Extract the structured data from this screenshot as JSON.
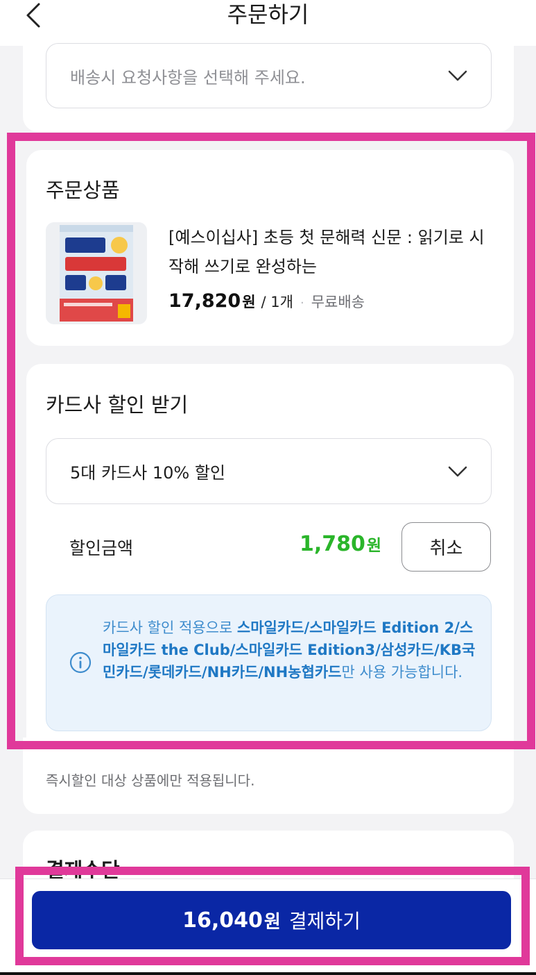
{
  "header": {
    "title": "주문하기",
    "back_icon": "chevron-left-icon"
  },
  "delivery_request": {
    "placeholder": "배송시 요청사항을 선택해 주세요.",
    "icon": "chevron-down-icon"
  },
  "order_product": {
    "section_title": "주문상품",
    "thumbnail_icon": "book-cover-image",
    "product_name": "[예스이십사] 초등 첫 문해력 신문 : 읽기로 시작해 쓰기로 완성하는",
    "price": "17,820",
    "price_unit": "원",
    "quantity": "/ 1개",
    "separator": "·",
    "shipping": "무료배송"
  },
  "card_discount": {
    "section_title": "카드사 할인 받기",
    "selected_option": "5대 카드사 10% 할인",
    "discount_label": "할인금액",
    "discount_amount": "1,780",
    "discount_unit": "원",
    "cancel_label": "취소",
    "info_icon": "info-circle-icon",
    "info_prefix": "카드사 할인 적용으로 ",
    "info_cards": "스마일카드/스마일카드 Edition 2/스마일카드 the Club/스마일카드 Edition3/삼성카드/KB국민카드/롯데카드/NH카드/NH농협카드",
    "info_suffix": "만 사용 가능합니다.",
    "note": "즉시할인 대상 상품에만 적용됩니다."
  },
  "payment": {
    "section_title": "결제수단",
    "total_amount": "16,040",
    "total_unit": "원",
    "pay_label": "결제하기"
  },
  "colors": {
    "highlight": "#e0399a",
    "pay_button": "#0a27a5",
    "discount_green": "#2ab52a",
    "info_blue": "#1f78c4"
  }
}
